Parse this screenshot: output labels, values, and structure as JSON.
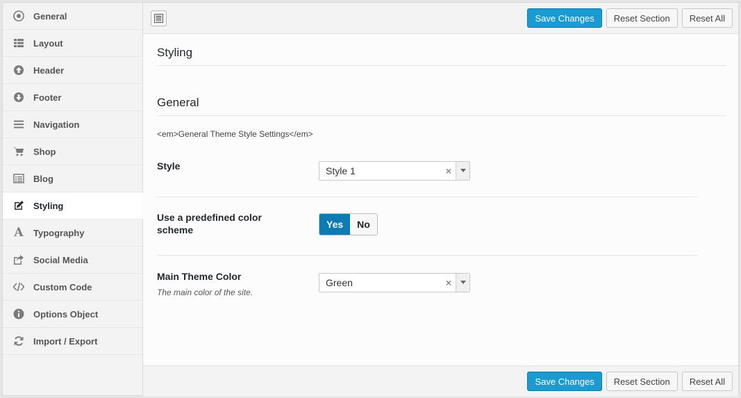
{
  "sidebar": {
    "items": [
      {
        "label": "General",
        "icon": "info-circle-icon"
      },
      {
        "label": "Layout",
        "icon": "list-icon"
      },
      {
        "label": "Header",
        "icon": "arrow-up-circle-icon"
      },
      {
        "label": "Footer",
        "icon": "arrow-down-circle-icon"
      },
      {
        "label": "Navigation",
        "icon": "bars-icon"
      },
      {
        "label": "Shop",
        "icon": "cart-icon"
      },
      {
        "label": "Blog",
        "icon": "list-alt-icon"
      },
      {
        "label": "Styling",
        "icon": "edit-icon",
        "active": true
      },
      {
        "label": "Typography",
        "icon": "font-icon"
      },
      {
        "label": "Social Media",
        "icon": "share-icon"
      },
      {
        "label": "Custom Code",
        "icon": "code-icon"
      },
      {
        "label": "Options Object",
        "icon": "info-icon"
      },
      {
        "label": "Import / Export",
        "icon": "refresh-icon"
      }
    ]
  },
  "toolbar": {
    "save_label": "Save Changes",
    "reset_section_label": "Reset Section",
    "reset_all_label": "Reset All",
    "expand_icon": "expand-icon"
  },
  "main": {
    "page_title": "Styling",
    "section_title": "General",
    "section_desc": "<em>General Theme Style Settings</em>",
    "fields": {
      "style": {
        "label": "Style",
        "value": "Style 1"
      },
      "predefined": {
        "label": "Use a predefined color scheme",
        "yes": "Yes",
        "no": "No",
        "selected": "Yes"
      },
      "main_color": {
        "label": "Main Theme Color",
        "sub": "The main color of the site.",
        "value": "Green"
      }
    }
  },
  "colors": {
    "accent": "#1a9cd2",
    "toggle_on": "#0e7bb3"
  }
}
